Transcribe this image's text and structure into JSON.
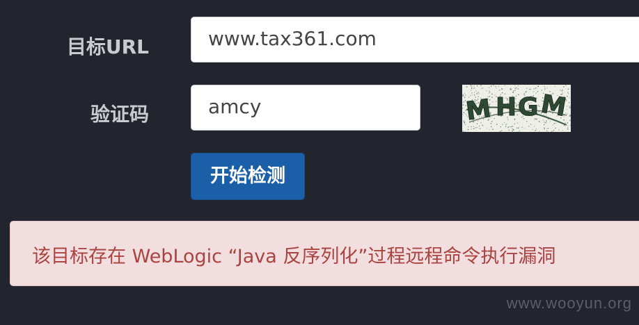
{
  "form": {
    "url_label": "目标URL",
    "url_value": "www.tax361.com",
    "captcha_label": "验证码",
    "captcha_value": "amcy",
    "captcha_image_text": "MHGM",
    "submit_label": "开始检测"
  },
  "alert": {
    "message": "该目标存在 WebLogic “Java 反序列化”过程远程命令执行漏洞"
  },
  "watermark": "www.wooyun.org",
  "colors": {
    "background": "#22252d",
    "button": "#1a5fa8",
    "alert_background": "#f2dede",
    "alert_text": "#a94442"
  }
}
